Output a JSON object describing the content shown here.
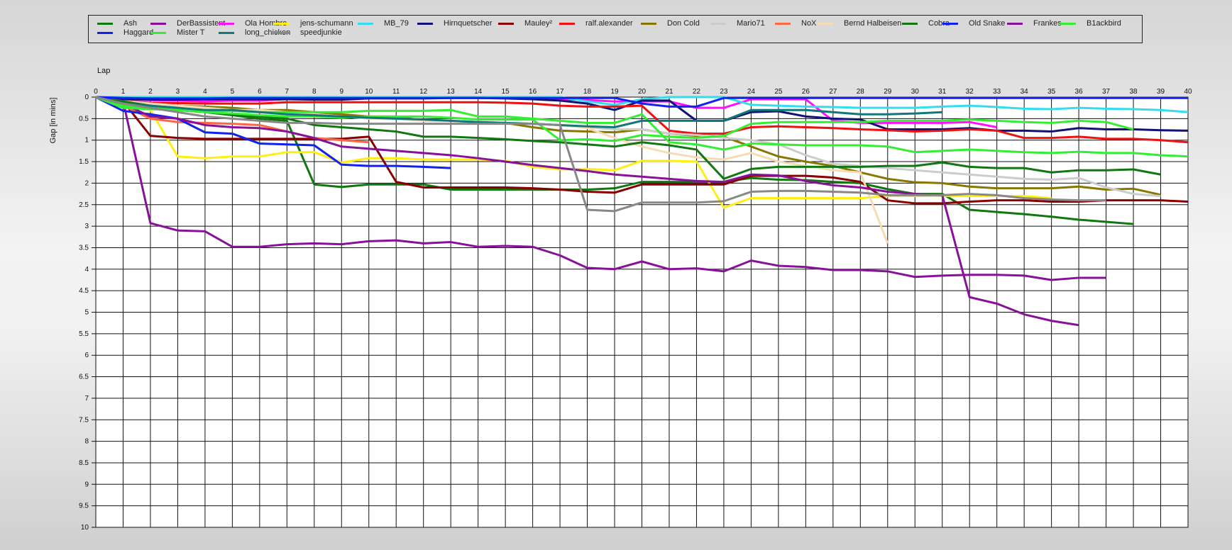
{
  "chart_data": {
    "type": "line",
    "xlabel": "Lap",
    "ylabel": "Gap [in mins]",
    "xlim": [
      0,
      40
    ],
    "ylim": [
      0,
      10
    ],
    "y_inverted": true,
    "x_ticks": [
      0,
      1,
      2,
      3,
      4,
      5,
      6,
      7,
      8,
      9,
      10,
      11,
      12,
      13,
      14,
      15,
      16,
      17,
      18,
      19,
      20,
      21,
      22,
      23,
      24,
      25,
      26,
      27,
      28,
      29,
      30,
      31,
      32,
      33,
      34,
      35,
      36,
      37,
      38,
      39,
      40
    ],
    "y_ticks": [
      "0",
      "0.5",
      "1",
      "1.5",
      "2",
      "2.5",
      "3",
      "3.5",
      "4",
      "4.5",
      "5",
      "5.5",
      "6",
      "6.5",
      "7",
      "7.5",
      "8",
      "8.5",
      "9",
      "9.5",
      "10"
    ],
    "grid": true,
    "legend_position": "top",
    "series": [
      {
        "name": "Ash",
        "color": "#117711",
        "values": [
          0,
          0.15,
          0.25,
          0.3,
          0.35,
          0.42,
          0.5,
          0.55,
          2.03,
          2.09,
          2.03,
          2.03,
          2.03,
          2.15,
          2.15,
          2.15,
          2.15,
          2.15,
          2.15,
          2.12,
          1.97,
          1.97,
          1.97,
          1.97,
          1.88,
          1.92,
          1.93,
          1.97,
          2.0,
          2.14,
          2.25,
          2.25,
          2.62,
          2.67,
          2.72,
          2.78,
          2.85,
          2.9,
          2.95
        ]
      },
      {
        "name": "DerBassistent",
        "color": "#881199",
        "values": [
          0,
          0.1,
          2.93,
          3.1,
          3.12,
          3.48,
          3.48,
          3.42,
          3.4,
          3.42,
          3.35,
          3.33,
          3.4,
          3.37,
          3.48,
          3.46,
          3.48,
          3.68,
          3.97,
          4.0,
          3.82,
          4.0,
          3.98,
          4.05,
          3.8,
          3.92,
          3.95,
          4.02,
          4.02,
          4.05,
          4.18,
          4.15,
          4.13,
          4.13,
          4.15,
          4.25,
          4.2,
          4.2
        ]
      },
      {
        "name": "Ola Hombre",
        "color": "#ff11ff",
        "values": [
          0,
          0.05,
          0.07,
          0.08,
          0.1,
          0.08,
          0.08,
          0.05,
          0.05,
          0.05,
          0.02,
          0.02,
          0.02,
          0.02,
          0.02,
          0.02,
          0.03,
          0.05,
          0.07,
          0.1,
          0.1,
          0.1,
          0.25,
          0.25,
          0.05,
          0.05,
          0.05,
          0.55,
          0.6,
          0.6,
          0.6,
          0.6,
          0.58,
          0.7
        ]
      },
      {
        "name": "jens-schumann",
        "color": "#ffee11",
        "values": [
          0,
          0.2,
          0.3,
          1.38,
          1.42,
          1.38,
          1.38,
          1.28,
          1.28,
          1.52,
          1.42,
          1.42,
          1.45,
          1.45,
          1.45,
          1.48,
          1.62,
          1.68,
          1.67,
          1.7,
          1.48,
          1.48,
          1.5,
          2.57,
          2.35,
          2.35,
          2.35,
          2.35,
          2.35,
          2.3,
          2.3,
          2.3,
          2.3,
          2.3,
          2.3,
          2.35
        ]
      },
      {
        "name": "MB_79",
        "color": "#33ddee",
        "values": [
          0,
          0,
          0,
          0,
          0,
          0,
          0,
          0,
          0,
          0,
          0,
          0,
          0,
          0,
          0,
          0,
          0,
          0,
          0.1,
          0.18,
          0.05,
          0.0,
          0.0,
          0.0,
          0.18,
          0.2,
          0.22,
          0.23,
          0.25,
          0.25,
          0.25,
          0.22,
          0.2,
          0.23,
          0.27,
          0.28,
          0.25,
          0.27,
          0.28,
          0.3,
          0.35
        ]
      },
      {
        "name": "Hirnquetscher",
        "color": "#111177",
        "values": [
          0,
          0.05,
          0.06,
          0.06,
          0.05,
          0.05,
          0.05,
          0.05,
          0.06,
          0.06,
          0.03,
          0.03,
          0.03,
          0.02,
          0.02,
          0.03,
          0.05,
          0.08,
          0.15,
          0.3,
          0.08,
          0.08,
          0.55,
          0.55,
          0.35,
          0.33,
          0.45,
          0.5,
          0.52,
          0.75,
          0.75,
          0.75,
          0.72,
          0.78,
          0.78,
          0.8,
          0.72,
          0.75,
          0.75,
          0.77,
          0.78
        ]
      },
      {
        "name": "Mauley²",
        "color": "#880000",
        "values": [
          0,
          0.1,
          0.9,
          0.95,
          0.97,
          0.97,
          0.97,
          0.97,
          0.97,
          0.97,
          0.92,
          1.97,
          2.1,
          2.1,
          2.1,
          2.1,
          2.12,
          2.15,
          2.2,
          2.22,
          2.03,
          2.03,
          2.03,
          2.03,
          1.83,
          1.83,
          1.83,
          1.87,
          1.97,
          2.4,
          2.47,
          2.47,
          2.43,
          2.4,
          2.4,
          2.43,
          2.43,
          2.4,
          2.4,
          2.4,
          2.43
        ]
      },
      {
        "name": "ralf.alexander",
        "color": "#ee1111",
        "values": [
          0,
          0.1,
          0.13,
          0.14,
          0.15,
          0.15,
          0.15,
          0.12,
          0.12,
          0.12,
          0.12,
          0.12,
          0.12,
          0.12,
          0.12,
          0.13,
          0.15,
          0.2,
          0.22,
          0.22,
          0.2,
          0.78,
          0.85,
          0.85,
          0.7,
          0.68,
          0.7,
          0.72,
          0.75,
          0.77,
          0.8,
          0.78,
          0.75,
          0.78,
          0.95,
          0.95,
          0.92,
          0.97,
          0.97,
          1.0,
          1.05
        ]
      },
      {
        "name": "Don Cold",
        "color": "#887700",
        "values": [
          0,
          0.12,
          0.18,
          0.2,
          0.22,
          0.25,
          0.3,
          0.3,
          0.35,
          0.4,
          0.45,
          0.45,
          0.55,
          0.55,
          0.58,
          0.6,
          0.7,
          0.78,
          0.8,
          0.82,
          0.75,
          0.85,
          0.9,
          0.92,
          1.15,
          1.38,
          1.5,
          1.6,
          1.75,
          1.9,
          1.98,
          2.0,
          2.08,
          2.12,
          2.12,
          2.12,
          2.08,
          2.15,
          2.13,
          2.27
        ]
      },
      {
        "name": "Mario71",
        "color": "#cccccc",
        "values": [
          0,
          0.1,
          0.15,
          0.2,
          0.25,
          0.3,
          0.3,
          0.35,
          0.4,
          0.45,
          0.5,
          0.5,
          0.55,
          0.55,
          0.58,
          0.6,
          0.62,
          0.65,
          0.7,
          0.75,
          0.75,
          0.85,
          0.88,
          0.95,
          1.0,
          1.1,
          1.35,
          1.55,
          1.6,
          1.65,
          1.7,
          1.75,
          1.8,
          1.85,
          1.9,
          1.92,
          1.88,
          2.1,
          2.25,
          2.3
        ]
      },
      {
        "name": "NoX",
        "color": "#ff6644",
        "values": [
          0,
          0.2,
          0.5,
          0.58,
          0.6,
          0.62,
          0.65,
          0.8,
          0.95,
          1.0,
          1.05
        ]
      },
      {
        "name": "Bernd Halbeisen",
        "color": "#f5dcb4",
        "values": [
          0,
          0.1,
          0.15,
          0.2,
          0.25,
          0.3,
          0.3,
          0.35,
          0.4,
          0.45,
          0.5,
          0.5,
          0.55,
          0.55,
          0.58,
          0.6,
          0.62,
          0.65,
          0.72,
          0.95,
          1.15,
          1.3,
          1.4,
          1.45,
          1.3,
          1.5,
          1.6,
          1.7,
          1.75,
          3.4
        ]
      },
      {
        "name": "Cobra",
        "color": "#117711",
        "values": [
          0,
          0.1,
          0.2,
          0.3,
          0.35,
          0.4,
          0.45,
          0.5,
          0.65,
          0.7,
          0.75,
          0.8,
          0.92,
          0.92,
          0.95,
          0.98,
          1.02,
          1.05,
          1.1,
          1.15,
          1.05,
          1.12,
          1.22,
          1.9,
          1.67,
          1.62,
          1.62,
          1.62,
          1.62,
          1.6,
          1.6,
          1.52,
          1.62,
          1.65,
          1.65,
          1.75,
          1.7,
          1.7,
          1.68,
          1.8
        ]
      },
      {
        "name": "Old Snake",
        "color": "#1122ee",
        "values": [
          0,
          0.32,
          0.4,
          0.5,
          0.82,
          0.85,
          1.08,
          1.1,
          1.12,
          1.57,
          1.6,
          1.6,
          1.62,
          1.65
        ]
      },
      {
        "name": "Frankes",
        "color": "#881199",
        "values": [
          0,
          0.15,
          0.45,
          0.5,
          0.65,
          0.7,
          0.72,
          0.8,
          0.95,
          1.15,
          1.2,
          1.25,
          1.3,
          1.35,
          1.42,
          1.5,
          1.58,
          1.65,
          1.72,
          1.8,
          1.85,
          1.9,
          1.95,
          1.97,
          1.8,
          1.82,
          1.95,
          2.05,
          2.1,
          2.2,
          2.25,
          2.28,
          4.65,
          4.8,
          5.05,
          5.2,
          5.3
        ]
      },
      {
        "name": "B1ackbird",
        "color": "#33ee33",
        "values": [
          0,
          0.25,
          0.28,
          0.3,
          0.32,
          0.32,
          0.35,
          0.35,
          0.35,
          0.35,
          0.32,
          0.32,
          0.32,
          0.3,
          0.45,
          0.45,
          0.5,
          0.55,
          0.6,
          0.6,
          0.4,
          1.05,
          1.1,
          1.22,
          1.08,
          1.1,
          1.12,
          1.12,
          1.12,
          1.15,
          1.28,
          1.25,
          1.22,
          1.25,
          1.28,
          1.3,
          1.27,
          1.3,
          1.3,
          1.35,
          1.38
        ]
      },
      {
        "name": "Haggard",
        "color": "#1122ee",
        "values": [
          0,
          0.02,
          0.03,
          0.03,
          0.03,
          0.02,
          0.02,
          0.02,
          0.02,
          0.02,
          0.02,
          0.02,
          0.02,
          0.02,
          0.02,
          0.02,
          0.02,
          0.02,
          0.02,
          0.02,
          0.15,
          0.22,
          0.22,
          0.02,
          0.02,
          0.02,
          0.02,
          0.02,
          0.02,
          0.02,
          0.02,
          0.02,
          0.02,
          0.02,
          0.02,
          0.02,
          0.02,
          0.02,
          0.02,
          0.02,
          0.02
        ]
      },
      {
        "name": "Mister T",
        "color": "#33ee33",
        "values": [
          0,
          0.2,
          0.25,
          0.3,
          0.35,
          0.38,
          0.42,
          0.45,
          0.45,
          0.48,
          0.45,
          0.45,
          0.45,
          0.48,
          0.52,
          0.52,
          0.52,
          1.0,
          0.98,
          1.02,
          0.88,
          0.92,
          0.95,
          0.9,
          0.62,
          0.58,
          0.58,
          0.58,
          0.58,
          0.55,
          0.55,
          0.55,
          0.52,
          0.55,
          0.58,
          0.6,
          0.55,
          0.58,
          0.75
        ]
      },
      {
        "name": "long_chicken",
        "color": "#117777",
        "values": [
          0,
          0.15,
          0.2,
          0.25,
          0.3,
          0.3,
          0.35,
          0.4,
          0.42,
          0.45,
          0.48,
          0.5,
          0.52,
          0.55,
          0.58,
          0.6,
          0.62,
          0.65,
          0.68,
          0.7,
          0.55,
          0.55,
          0.55,
          0.55,
          0.3,
          0.3,
          0.3,
          0.35,
          0.4,
          0.4,
          0.38,
          0.35
        ]
      },
      {
        "name": "speedjunkie",
        "color": "#888888",
        "values": [
          0,
          0.15,
          0.25,
          0.35,
          0.45,
          0.5,
          0.55,
          0.6,
          0.6,
          0.62,
          0.62,
          0.62,
          0.62,
          0.62,
          0.62,
          0.62,
          0.62,
          0.65,
          2.62,
          2.65,
          2.45,
          2.45,
          2.45,
          2.42,
          2.2,
          2.18,
          2.18,
          2.2,
          2.22,
          2.28,
          2.28,
          2.28,
          2.25,
          2.28,
          2.35,
          2.38,
          2.4,
          2.4
        ]
      }
    ]
  }
}
